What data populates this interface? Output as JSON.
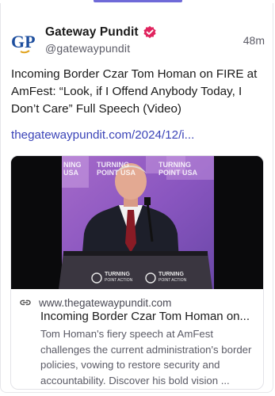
{
  "post": {
    "author": {
      "display_name": "Gateway Pundit",
      "handle": "@gatewaypundit",
      "avatar_text": "GP",
      "avatar_icon": "gateway-pundit-logo",
      "verified_icon": "verified-badge-icon"
    },
    "timestamp": "48m",
    "text": "Incoming Border Czar Tom Homan on FIRE at AmFest: “Look, if I Offend Anybody Today, I Don’t Care” Full Speech (Video)",
    "link": "thegatewaypundit.com/2024/12/i..."
  },
  "link_card": {
    "image_icon": "speaker-at-podium-image",
    "domain_icon": "link-icon",
    "domain": "www.thegatewaypundit.com",
    "title": "Incoming Border Czar Tom Homan on...",
    "description": "Tom Homan's fiery speech at AmFest challenges the current administration's border policies, vowing to restore security and accountability. Discover his bold vision ..."
  },
  "colors": {
    "accent_tab": "#6f6ad8",
    "link": "#3b44b8",
    "verified": "#e0245e",
    "avatar_blue": "#1d4e9e"
  }
}
